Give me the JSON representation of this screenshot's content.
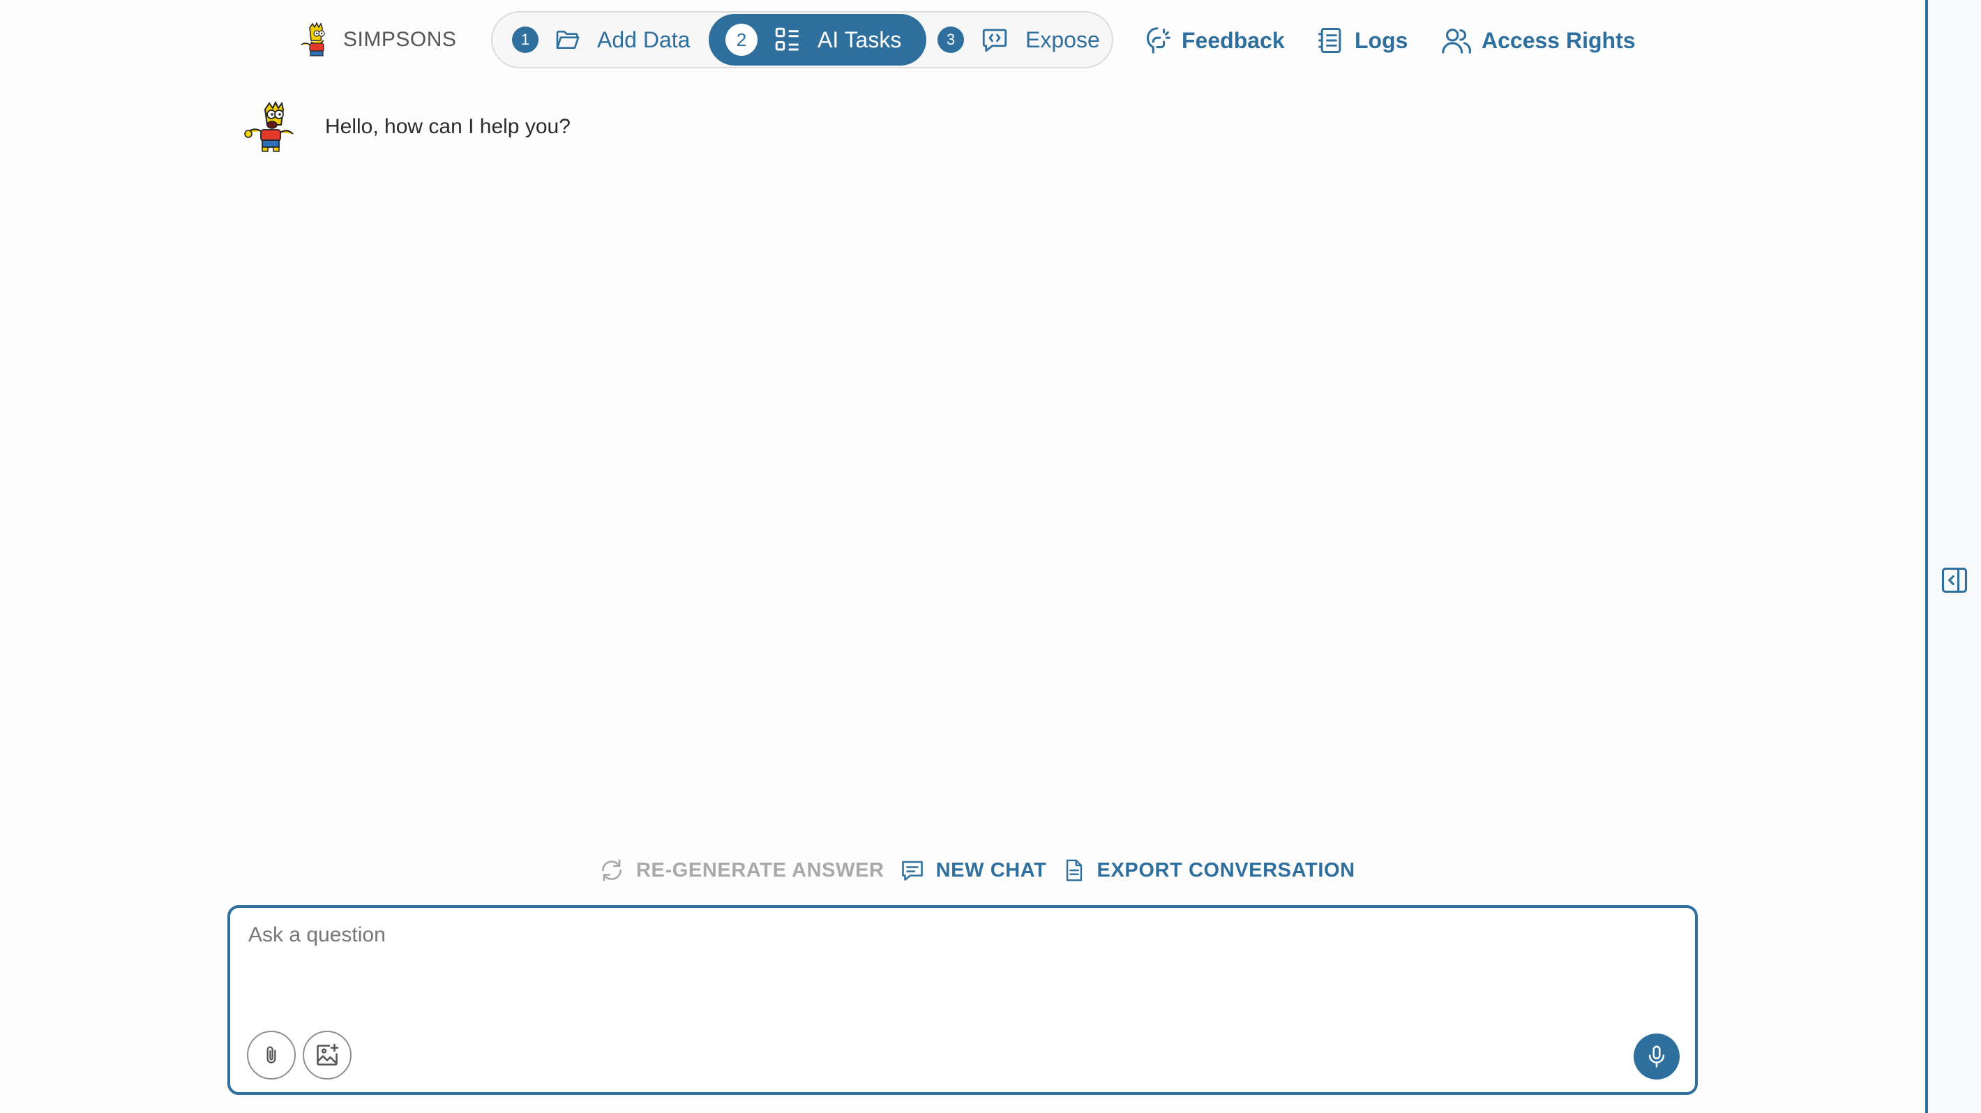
{
  "header": {
    "brand": "SIMPSONS",
    "steps": [
      {
        "number": "1",
        "label": "Add Data",
        "icon": "folder-open-icon"
      },
      {
        "number": "2",
        "label": "AI Tasks",
        "icon": "task-list-icon",
        "active": true
      },
      {
        "number": "3",
        "label": "Expose",
        "icon": "code-chat-icon"
      }
    ],
    "links": [
      {
        "label": "Feedback",
        "icon": "feedback-icon"
      },
      {
        "label": "Logs",
        "icon": "logs-icon"
      },
      {
        "label": "Access Rights",
        "icon": "users-icon"
      }
    ]
  },
  "chat": {
    "messages": [
      {
        "author": "assistant",
        "text": "Hello, how can I help you?"
      }
    ]
  },
  "actions": {
    "regenerate": "RE-GENERATE ANSWER",
    "new_chat": "NEW CHAT",
    "export": "EXPORT CONVERSATION"
  },
  "input": {
    "placeholder": "Ask a question",
    "value": ""
  },
  "colors": {
    "accent": "#2e6f9e",
    "disabled": "#a9a9a9",
    "text": "#2b2b2b"
  }
}
